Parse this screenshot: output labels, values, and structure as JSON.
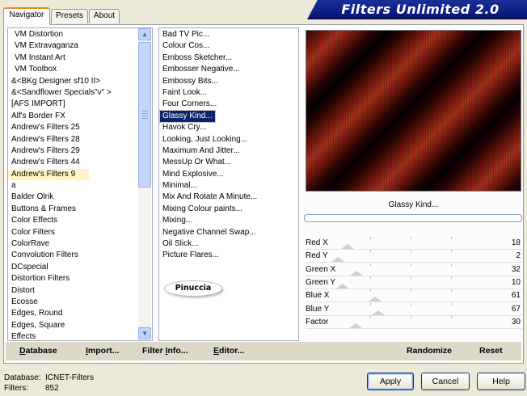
{
  "banner": {
    "title": "Filters Unlimited 2.0"
  },
  "tabs": [
    {
      "label": "Navigator",
      "active": true
    },
    {
      "label": "Presets",
      "active": false
    },
    {
      "label": "About",
      "active": false
    }
  ],
  "categories": {
    "items": [
      "VM Distortion",
      "VM Extravaganza",
      "VM Instant Art",
      "VM Toolbox",
      "&<BKg Designer sf10 II>",
      "&<Sandflower Specials\"v\" >",
      "[AFS IMPORT]",
      "Alf's Border FX",
      "Andrew's Filters 25",
      "Andrew's Filters 28",
      "Andrew's Filters 29",
      "Andrew's Filters 44",
      "Andrew's Filters 9",
      "a",
      "Balder Olrik",
      "Buttons & Frames",
      "Color Effects",
      "Color Filters",
      "ColorRave",
      "Convolution Filters",
      "DCspecial",
      "Distortion Filters",
      "Distort",
      "Ecosse",
      "Edges, Round",
      "Edges, Square",
      "Effects"
    ],
    "selected": "Andrew's Filters 9"
  },
  "filters": {
    "items": [
      "Bad TV Pic...",
      "Colour Cos...",
      "Emboss Sketcher...",
      "Embosser Negative...",
      "Embossy Bits...",
      "Faint Look...",
      "Four Corners...",
      "Glassy Kind...",
      "Havok Cry...",
      "Looking, Just Looking...",
      "Maximum And Jitter...",
      "MessUp Or What...",
      "Mind Explosive...",
      "Minimal...",
      "Mix And Rotate A Minute...",
      "Mixing Colour paints...",
      "Mixing...",
      "Negative Channel Swap...",
      "Oil Slick...",
      "Picture Flares..."
    ],
    "selected": "Glassy Kind..."
  },
  "logo": {
    "text": "Pinuccia"
  },
  "preview": {
    "filter_name": "Glassy Kind..."
  },
  "sliders": [
    {
      "label": "Red X",
      "value": "18",
      "fraction": 0.07
    },
    {
      "label": "Red Y",
      "value": "2",
      "fraction": 0.01
    },
    {
      "label": "Green X",
      "value": "32",
      "fraction": 0.125
    },
    {
      "label": "Green Y",
      "value": "10",
      "fraction": 0.04
    },
    {
      "label": "Blue X",
      "value": "61",
      "fraction": 0.24
    },
    {
      "label": "Blue Y",
      "value": "67",
      "fraction": 0.26
    },
    {
      "label": "Factor",
      "value": "30",
      "fraction": 0.12
    }
  ],
  "bottom_buttons": {
    "database": {
      "u": "D",
      "rest": "atabase"
    },
    "import": {
      "u": "I",
      "rest": "mport..."
    },
    "filter_info": {
      "pre": "Filter ",
      "u": "I",
      "rest": "nfo..."
    },
    "editor": {
      "u": "E",
      "rest": "ditor..."
    },
    "randomize": "Randomize",
    "reset": "Reset"
  },
  "footer": {
    "database_label": "Database:",
    "database_value": "ICNET-Filters",
    "filters_label": "Filters:",
    "filters_value": "852"
  },
  "dialog_buttons": {
    "apply": "Apply",
    "cancel": "Cancel",
    "help": "Help"
  }
}
